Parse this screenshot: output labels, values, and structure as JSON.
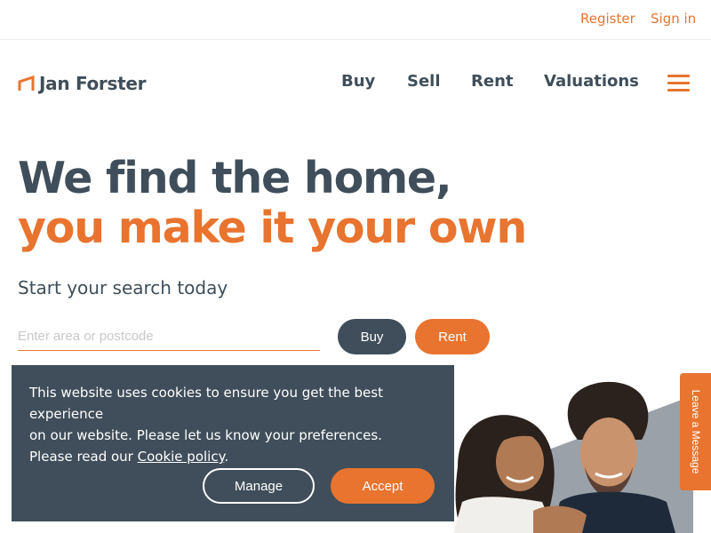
{
  "topbar": {
    "register": "Register",
    "sign_in": "Sign in"
  },
  "brand": {
    "name": "Jan Forster"
  },
  "nav": {
    "buy": "Buy",
    "sell": "Sell",
    "rent": "Rent",
    "valuations": "Valuations"
  },
  "hero": {
    "line1": "We find the home,",
    "line2": "you make it your own",
    "subheading": "Start your search today"
  },
  "search": {
    "placeholder": "Enter area or postcode",
    "value": "",
    "buy_label": "Buy",
    "rent_label": "Rent"
  },
  "cookie": {
    "line1": "This website uses cookies to ensure you get the best experience",
    "line2": "on our website. Please let us know your preferences.",
    "line3_prefix": "Please read our",
    "link": "Cookie policy",
    "line3_suffix": ".",
    "manage": "Manage",
    "accept": "Accept"
  },
  "leave_message": "Leave a Message",
  "icons": {
    "menu": "hamburger-menu-icon",
    "logo": "house-roof-logo-icon"
  },
  "colors": {
    "accent": "#e8742f",
    "primary": "#3f4e5a",
    "background": "#ffffff"
  }
}
